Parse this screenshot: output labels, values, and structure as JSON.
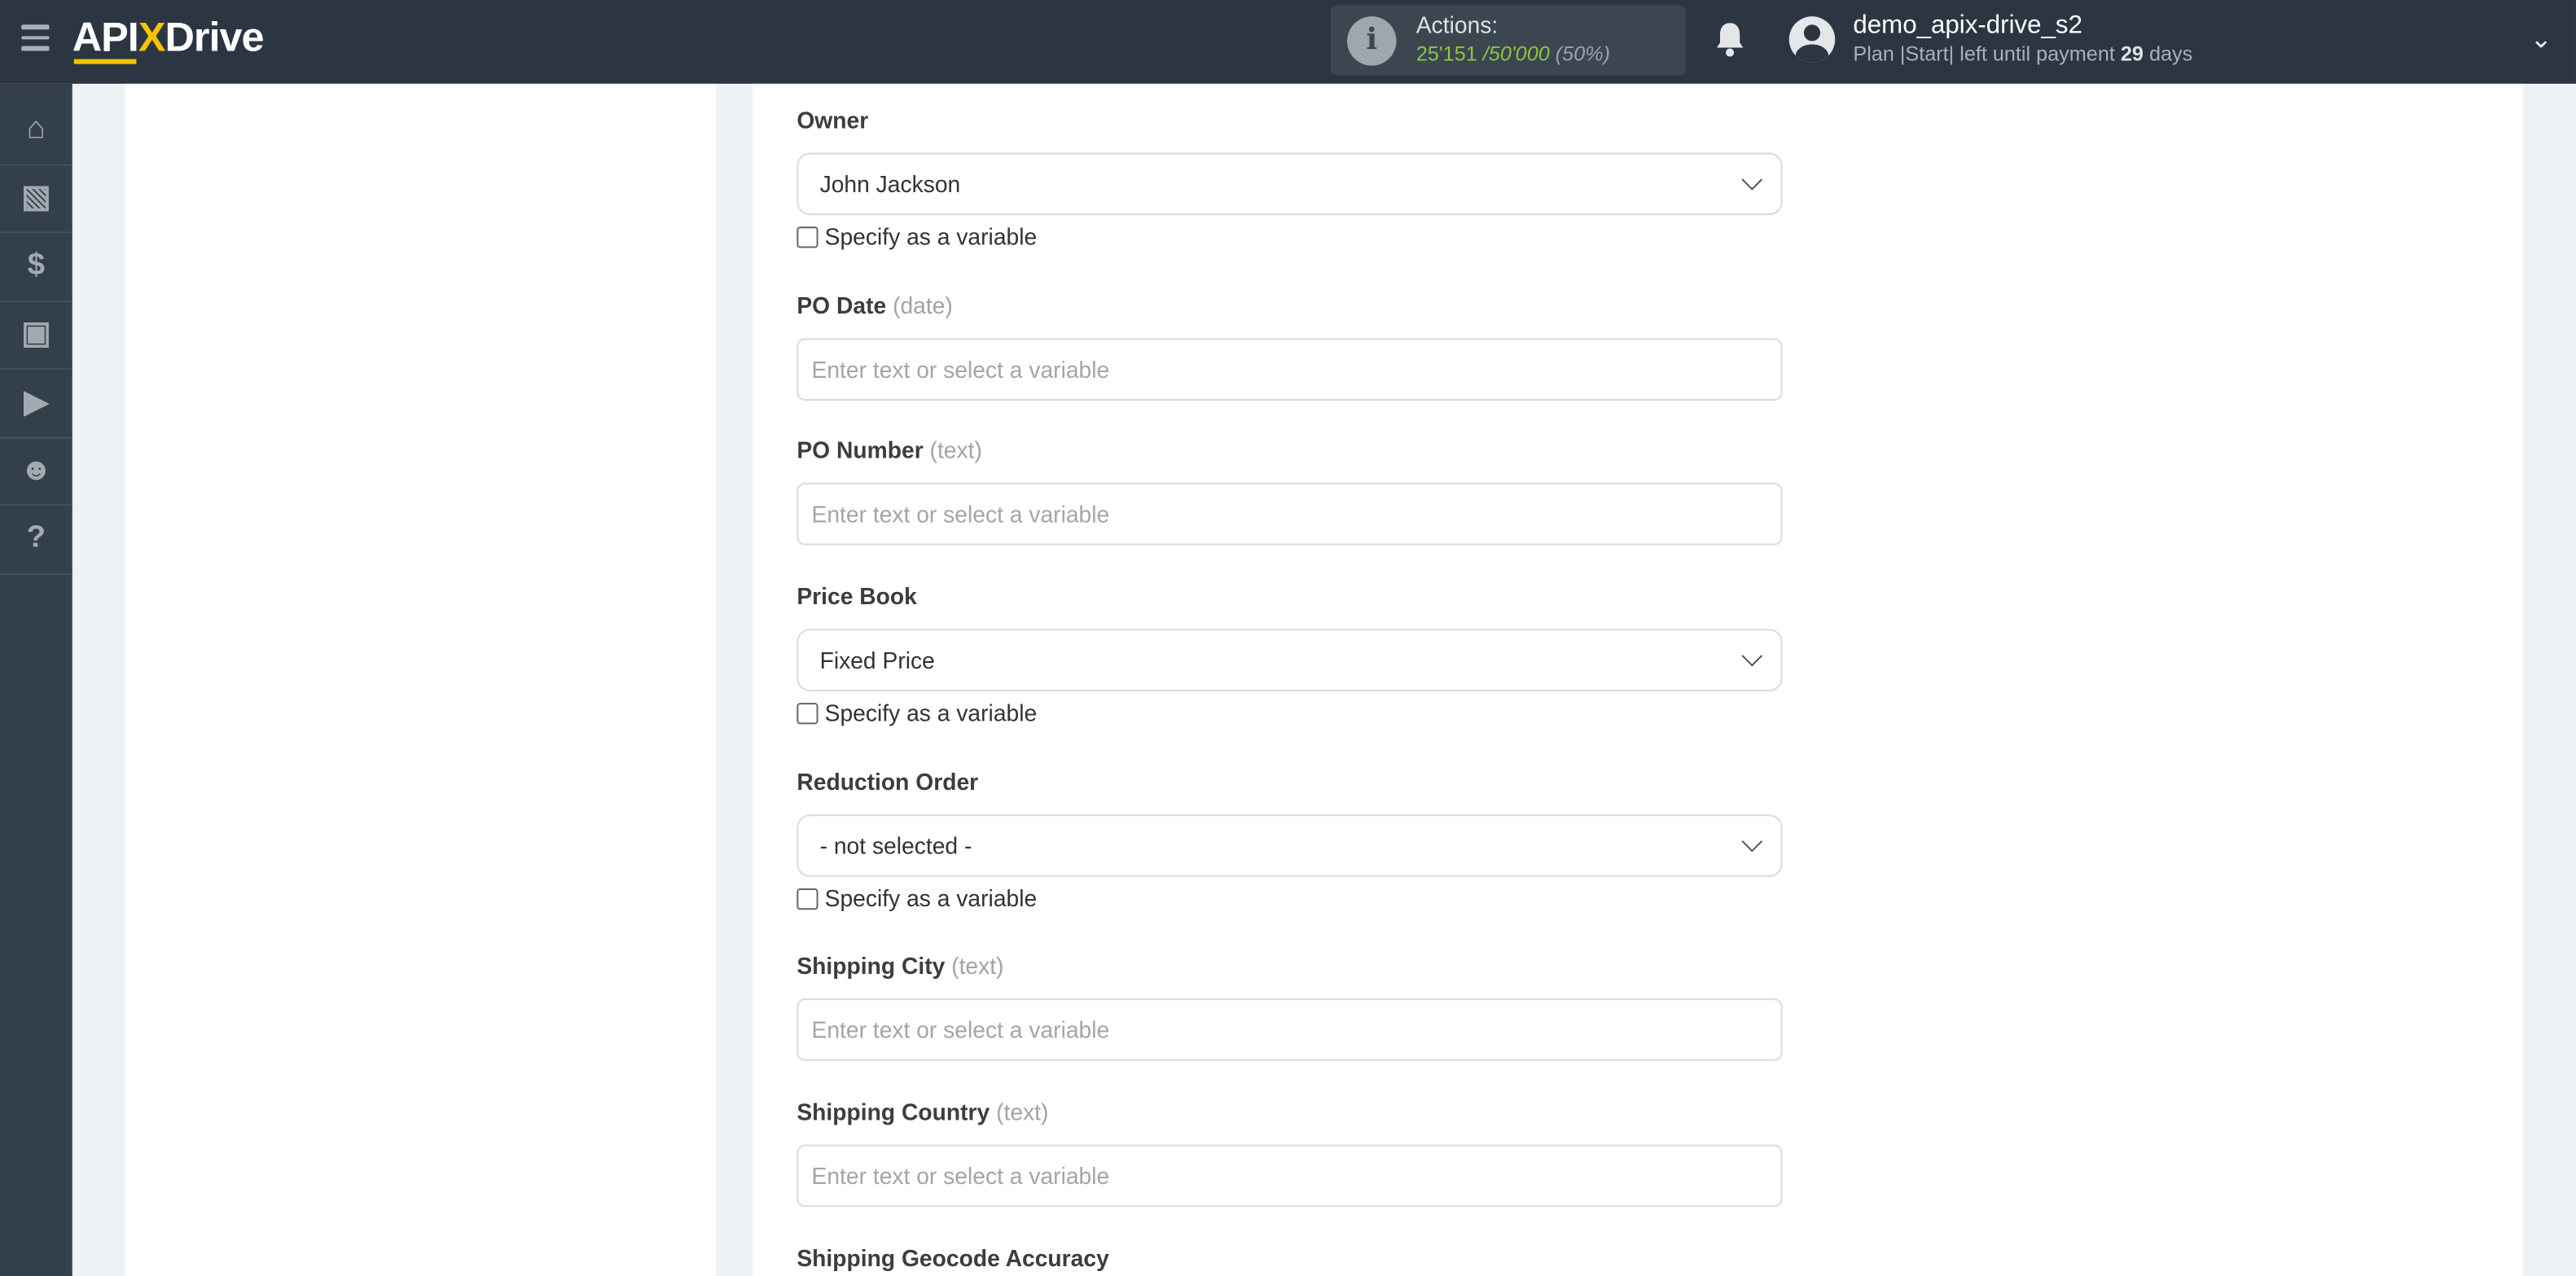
{
  "header": {
    "logo": {
      "a": "API",
      "x": "X",
      "b": "Drive"
    },
    "actions_label": "Actions:",
    "actions_used": "25'151",
    "actions_total": "/50'000",
    "actions_percent": "(50%)",
    "username": "demo_apix-drive_s2",
    "plan_prefix": "Plan |Start| left until payment",
    "plan_days": "29",
    "plan_suffix": "days"
  },
  "sidebar": {
    "items": [
      {
        "icon": "home-icon"
      },
      {
        "icon": "sitemap-icon"
      },
      {
        "icon": "dollar-icon"
      },
      {
        "icon": "briefcase-icon"
      },
      {
        "icon": "youtube-icon"
      },
      {
        "icon": "user-icon"
      },
      {
        "icon": "help-icon"
      }
    ]
  },
  "form": {
    "checkbox_label": "Specify as a variable",
    "placeholder": "Enter text or select a variable",
    "fields": [
      {
        "label": "Owner",
        "type": "",
        "value": "John Jackson"
      },
      {
        "label": "PO Date",
        "type": "(date)"
      },
      {
        "label": "PO Number",
        "type": "(text)"
      },
      {
        "label": "Price Book",
        "type": "",
        "value": "Fixed Price"
      },
      {
        "label": "Reduction Order",
        "type": "",
        "value": "- not selected -"
      },
      {
        "label": "Shipping City",
        "type": "(text)"
      },
      {
        "label": "Shipping Country",
        "type": "(text)"
      },
      {
        "label": "Shipping Geocode Accuracy",
        "type": ""
      }
    ]
  },
  "colors": {
    "header": "#2c3642",
    "sidebar": "#343f4c",
    "accent": "#f5c400",
    "actions_green": "#8cc63f"
  }
}
